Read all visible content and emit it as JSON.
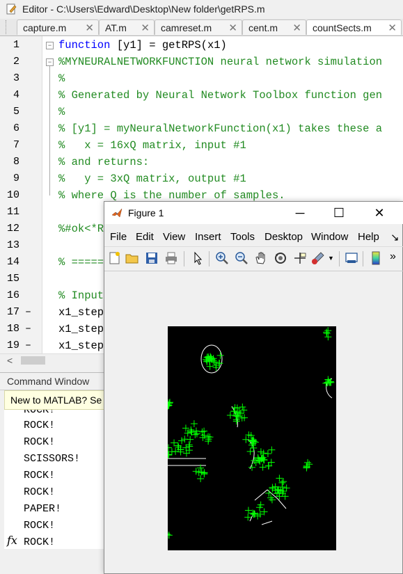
{
  "editor": {
    "title": "Editor - C:\\Users\\Edward\\Desktop\\New folder\\getRPS.m",
    "tabs": [
      {
        "label": "capture.m"
      },
      {
        "label": "AT.m"
      },
      {
        "label": "camreset.m"
      },
      {
        "label": "cent.m"
      },
      {
        "label": "countSects.m"
      }
    ],
    "lines": [
      {
        "n": "1",
        "text_kw": "function",
        "text": " [y1] = getRPS(x1)"
      },
      {
        "n": "2",
        "text": "%MYNEURALNETWORKFUNCTION neural network simulation"
      },
      {
        "n": "3",
        "text": "%"
      },
      {
        "n": "4",
        "text": "% Generated by Neural Network Toolbox function gen"
      },
      {
        "n": "5",
        "text": "%"
      },
      {
        "n": "6",
        "text": "% [y1] = myNeuralNetworkFunction(x1) takes these a"
      },
      {
        "n": "7",
        "text": "%   x = 16xQ matrix, input #1"
      },
      {
        "n": "8",
        "text": "% and returns:"
      },
      {
        "n": "9",
        "text": "%   y = 3xQ matrix, output #1"
      },
      {
        "n": "10",
        "text": "% where Q is the number of samples."
      },
      {
        "n": "11",
        "text": ""
      },
      {
        "n": "12",
        "text": "%#ok<*R"
      },
      {
        "n": "13",
        "text": ""
      },
      {
        "n": "14",
        "text": "% ====="
      },
      {
        "n": "15",
        "text": ""
      },
      {
        "n": "16",
        "text": "% Input"
      },
      {
        "n": "17",
        "text": "x1_step"
      },
      {
        "n": "18",
        "text": "x1_step"
      },
      {
        "n": "19",
        "text": "x1_step"
      }
    ]
  },
  "command_window": {
    "title": "Command Window",
    "banner": "New to MATLAB? Se",
    "output": [
      "ROCK!",
      "ROCK!",
      "ROCK!",
      "SCISSORS!",
      "ROCK!",
      "ROCK!",
      "PAPER!",
      "ROCK!",
      "ROCK!"
    ]
  },
  "figure": {
    "title": "Figure 1",
    "menus": [
      "File",
      "Edit",
      "View",
      "Insert",
      "Tools",
      "Desktop",
      "Window",
      "Help"
    ],
    "more_glyph": "»"
  }
}
